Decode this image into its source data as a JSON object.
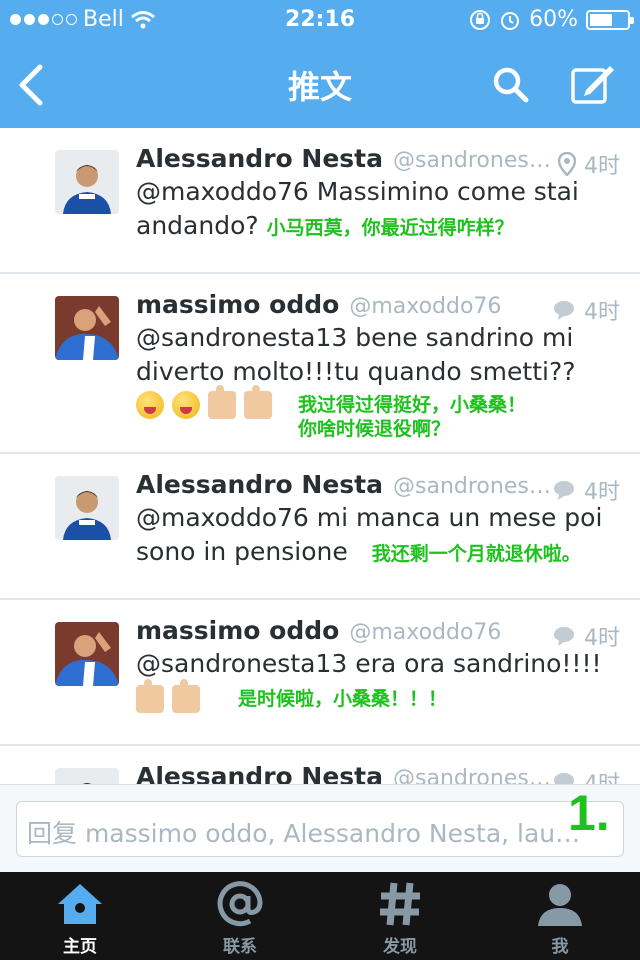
{
  "statusbar": {
    "carrier": "Bell",
    "time": "22:16",
    "battery": "60%",
    "battery_level": 0.6
  },
  "navbar": {
    "title": "推文"
  },
  "tweets": [
    {
      "name": "Alessandro Nesta",
      "handle": "@sandrones…",
      "meta_time": "4时",
      "meta_icon": "location-pin-icon",
      "text": "@maxoddo76 Massimino come stai andando?",
      "translation": "小马西莫，你最近过得咋样？"
    },
    {
      "name": "massimo oddo",
      "handle": "@maxoddo76",
      "meta_time": "4时",
      "meta_icon": "speech-bubble-icon",
      "text": "@sandronesta13 bene sandrino mi diverto molto!!!tu quando smetti??",
      "translation_l1": "我过得过得挺好，小桑桑！",
      "translation_l2": "你啥时候退役啊？"
    },
    {
      "name": "Alessandro Nesta",
      "handle": "@sandrones…",
      "meta_time": "4时",
      "meta_icon": "speech-bubble-icon",
      "text_l1": "@maxoddo76 mi manca un mese poi",
      "text_l2": "sono in pensione",
      "translation": "我还剩一个月就退休啦。"
    },
    {
      "name": "massimo oddo",
      "handle": "@maxoddo76",
      "meta_time": "4时",
      "meta_icon": "speech-bubble-icon",
      "text": "@sandronesta13 era ora sandrino!!!!",
      "translation": "是时候啦，小桑桑！！！"
    },
    {
      "name": "Alessandro Nesta",
      "handle": "@sandrones…",
      "meta_time": "4时"
    }
  ],
  "reply": {
    "placeholder": "回复 massimo oddo, Alessandro Nesta, lau…"
  },
  "annotation": {
    "page_number": "1."
  },
  "tabs": [
    {
      "label": "主页",
      "icon": "home-icon",
      "active": true
    },
    {
      "label": "联系",
      "icon": "at-sign-icon"
    },
    {
      "label": "发现",
      "icon": "hashtag-icon"
    },
    {
      "label": "我",
      "icon": "person-icon"
    }
  ]
}
